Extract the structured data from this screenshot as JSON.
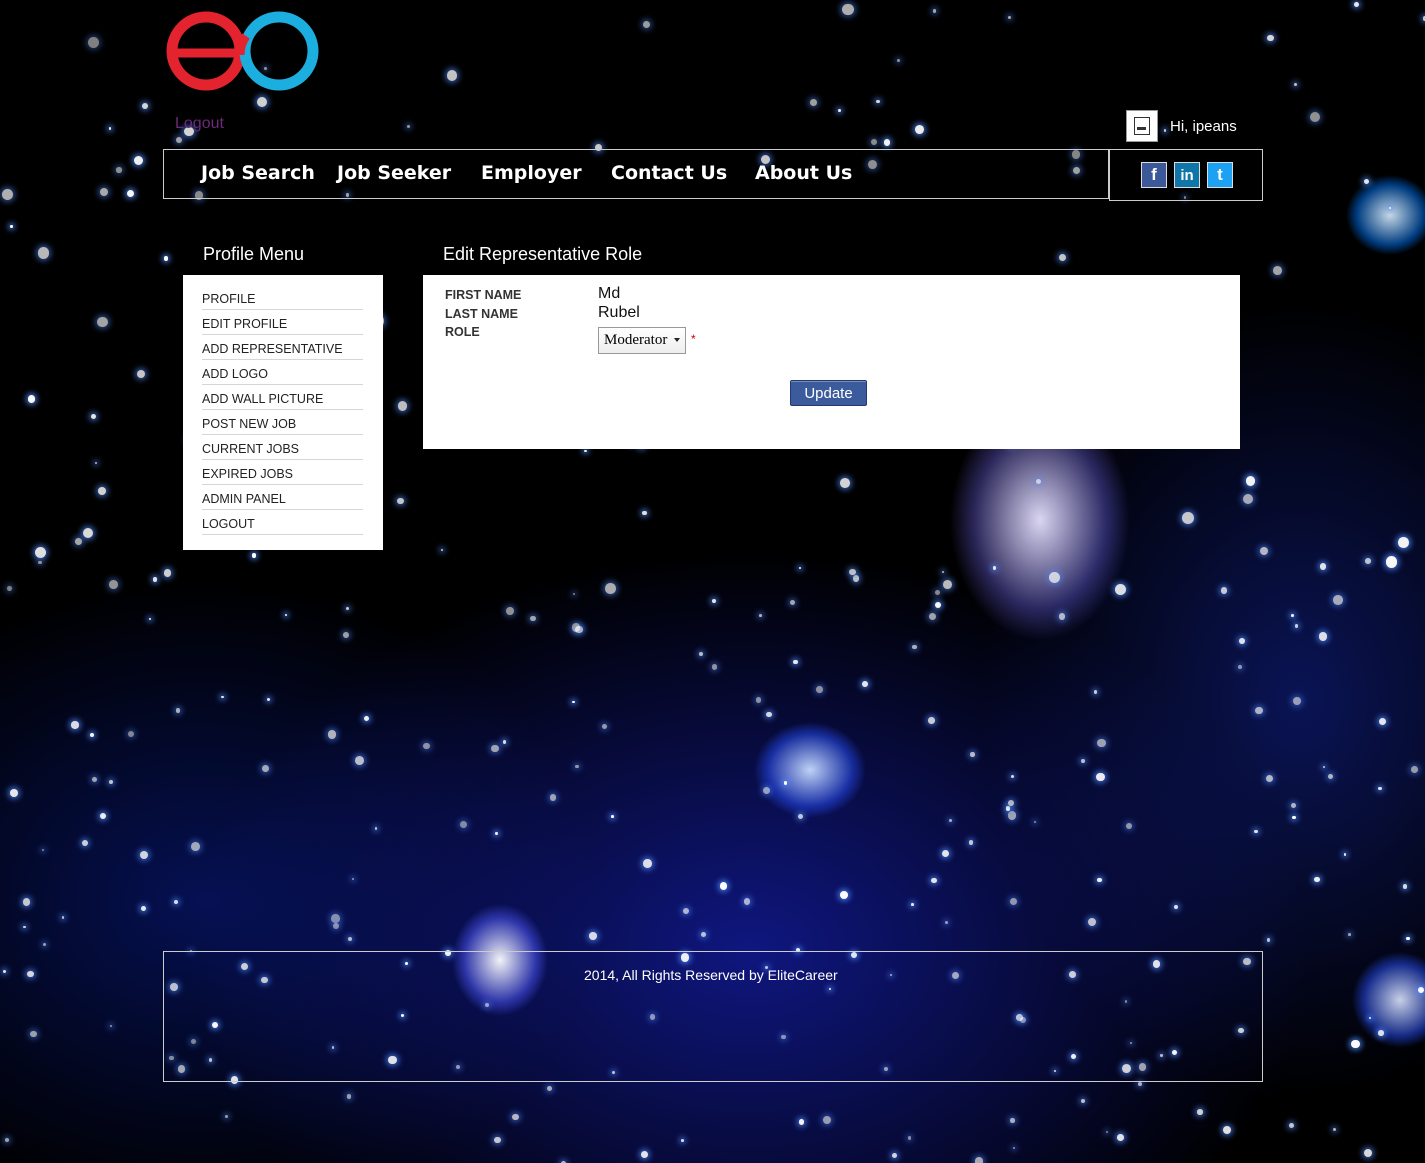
{
  "header": {
    "logout_label": "Logout",
    "greeting": "Hi, ipeans",
    "logo_colors": {
      "left_ring": "#e3232d",
      "right_ring": "#1daee0"
    }
  },
  "nav": {
    "items": [
      {
        "label": "Job Search"
      },
      {
        "label": "Job Seeker"
      },
      {
        "label": "Employer"
      },
      {
        "label": "Contact Us"
      },
      {
        "label": "About Us"
      }
    ],
    "social": [
      {
        "icon": "facebook-icon",
        "glyph": "f",
        "color": "#3b5998"
      },
      {
        "icon": "linkedin-icon",
        "glyph": "in",
        "color": "#0e76a8"
      },
      {
        "icon": "twitter-icon",
        "glyph": "t",
        "color": "#1da1f2"
      }
    ]
  },
  "sidebar": {
    "title": "Profile Menu",
    "items": [
      {
        "label": "PROFILE"
      },
      {
        "label": "EDIT PROFILE"
      },
      {
        "label": "ADD REPRESENTATIVE"
      },
      {
        "label": "ADD LOGO"
      },
      {
        "label": "ADD WALL PICTURE"
      },
      {
        "label": "POST NEW JOB"
      },
      {
        "label": "CURRENT JOBS"
      },
      {
        "label": "EXPIRED JOBS"
      },
      {
        "label": "ADMIN PANEL"
      },
      {
        "label": "LOGOUT"
      }
    ]
  },
  "main": {
    "title": "Edit Representative Role",
    "fields": {
      "first_name_label": "FIRST NAME",
      "first_name_value": "Md",
      "last_name_label": "LAST NAME",
      "last_name_value": "Rubel",
      "role_label": "ROLE",
      "role_value": "Moderator",
      "required_mark": "*"
    },
    "update_label": "Update"
  },
  "footer": {
    "text": "2014, All Rights Reserved by EliteCareer"
  }
}
